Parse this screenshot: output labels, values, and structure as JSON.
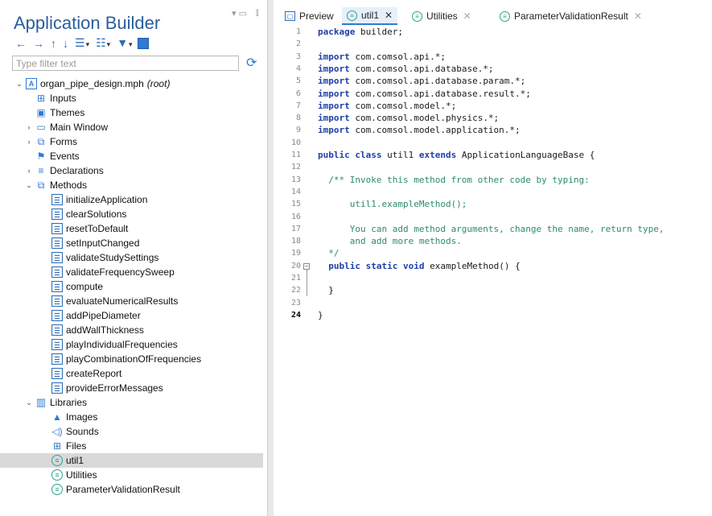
{
  "left_panel": {
    "title": "Application Builder",
    "filter_placeholder": "Type filter text",
    "toolbar_icons": [
      "back-arrow-icon",
      "forward-arrow-icon",
      "move-up-icon",
      "move-down-icon",
      "insert-dropdown-icon",
      "reorder-dropdown-icon",
      "style-dropdown-icon",
      "layout-icon"
    ]
  },
  "tree": {
    "root_name": "organ_pipe_design.mph",
    "root_suffix": "(root)",
    "inputs": "Inputs",
    "themes": "Themes",
    "main_window": "Main Window",
    "forms": "Forms",
    "events": "Events",
    "declarations": "Declarations",
    "methods_label": "Methods",
    "methods": [
      "initializeApplication",
      "clearSolutions",
      "resetToDefault",
      "setInputChanged",
      "validateStudySettings",
      "validateFrequencySweep",
      "compute",
      "evaluateNumericalResults",
      "addPipeDiameter",
      "addWallThickness",
      "playIndividualFrequencies",
      "playCombinationOfFrequencies",
      "createReport",
      "provideErrorMessages"
    ],
    "libraries_label": "Libraries",
    "images": "Images",
    "sounds": "Sounds",
    "files": "Files",
    "util": [
      "util1",
      "Utilities",
      "ParameterValidationResult"
    ],
    "selected": "util1"
  },
  "tabs": [
    {
      "label": "Preview",
      "active": false,
      "closable": false
    },
    {
      "label": "util1",
      "active": true,
      "closable": true
    },
    {
      "label": "Utilities",
      "active": false,
      "closable": true
    },
    {
      "label": "ParameterValidationResult",
      "active": false,
      "closable": true
    }
  ],
  "editor": {
    "lines": [
      "package builder;",
      "",
      "import com.comsol.api.*;",
      "import com.comsol.api.database.*;",
      "import com.comsol.api.database.param.*;",
      "import com.comsol.api.database.result.*;",
      "import com.comsol.model.*;",
      "import com.comsol.model.physics.*;",
      "import com.comsol.model.application.*;",
      "",
      "public class util1 extends ApplicationLanguageBase {",
      "",
      "  /** Invoke this method from other code by typing:",
      "",
      "      util1.exampleMethod();",
      "",
      "      You can add method arguments, change the name, return type,",
      "      and add more methods.",
      "  */",
      "  public static void exampleMethod() {",
      "",
      "  }",
      "",
      "}"
    ],
    "current_line": 24
  }
}
